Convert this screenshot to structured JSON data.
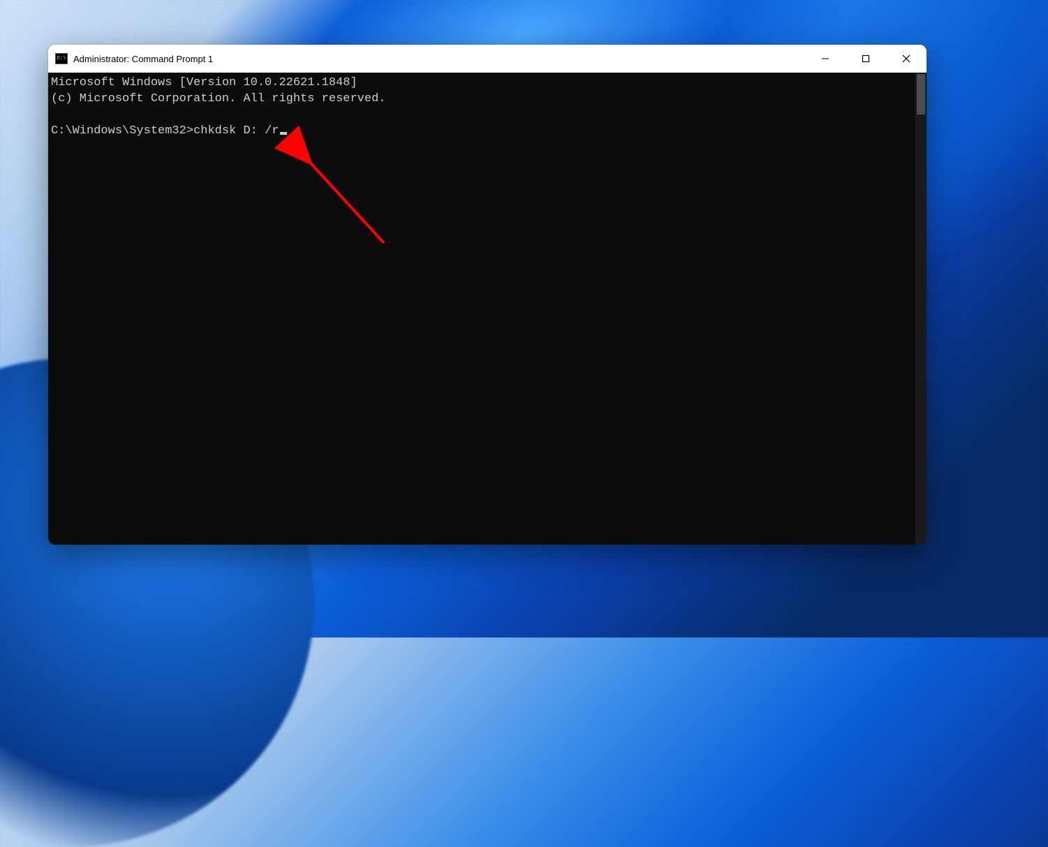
{
  "window": {
    "title": "Administrator: Command Prompt 1"
  },
  "terminal": {
    "line1": "Microsoft Windows [Version 10.0.22621.1848]",
    "line2": "(c) Microsoft Corporation. All rights reserved.",
    "blank": "",
    "prompt": "C:\\Windows\\System32>",
    "command": "chkdsk D: /r"
  },
  "annotation": {
    "type": "arrow",
    "color": "#ff0000"
  }
}
